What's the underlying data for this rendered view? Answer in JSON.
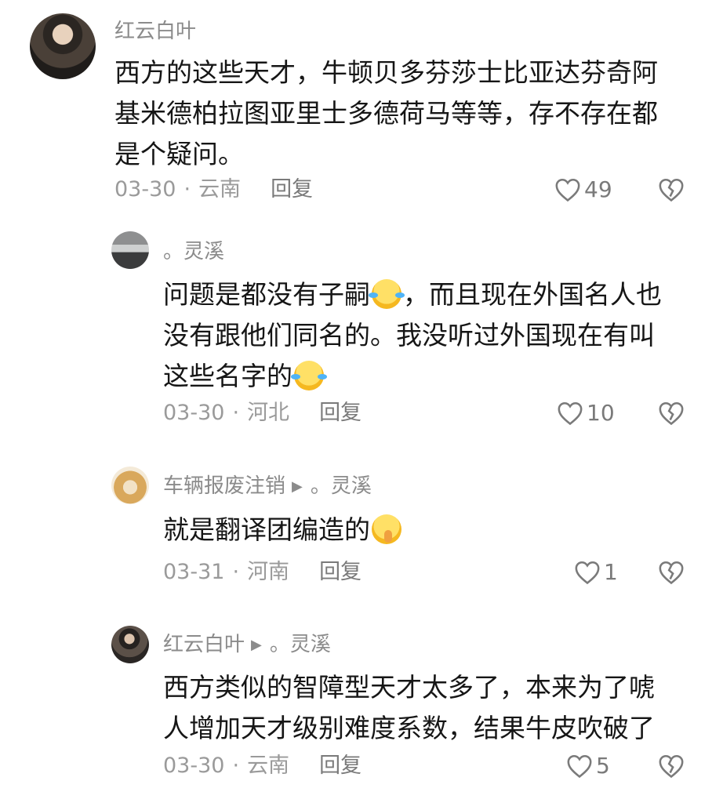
{
  "comments": [
    {
      "username": "红云白叶",
      "reply_to": "",
      "text_lines": [
        "西方的这些天才，牛顿贝多芬莎士比亚达芬奇阿",
        "基米德柏拉图亚里士多德荷马等等，存不存在都",
        "是个疑问。"
      ],
      "date": "03-30",
      "location": "云南",
      "reply_label": "回复",
      "likes": "49"
    },
    {
      "username": "。灵溪",
      "reply_to": "",
      "text_lines": [
        "问题是都没有子嗣",
        "，而且现在外国名人也",
        "没有跟他们同名的。我没听过外国现在有叫",
        "这些名字的"
      ],
      "date": "03-30",
      "location": "河北",
      "reply_label": "回复",
      "likes": "10"
    },
    {
      "username": "车辆报废注销",
      "reply_to": "。灵溪",
      "text_lines": [
        "就是翻译团编造的"
      ],
      "date": "03-31",
      "location": "河南",
      "reply_label": "回复",
      "likes": "1"
    },
    {
      "username": "红云白叶",
      "reply_to": "。灵溪",
      "text_lines": [
        "西方类似的智障型天才太多了，本来为了唬",
        "人增加天才级别难度系数，结果牛皮吹破了"
      ],
      "date": "03-30",
      "location": "云南",
      "reply_label": "回复",
      "likes": "5"
    }
  ],
  "separator": "·",
  "reply_arrow": "▶",
  "icons": {
    "like": "heart-outline-icon",
    "dislike": "broken-heart-icon",
    "emoji_laugh": "face-with-tears-of-joy",
    "emoji_hush": "shushing-face"
  },
  "colors": {
    "text": "#161616",
    "meta": "#9a9a9a",
    "username": "#8b8b8b"
  }
}
